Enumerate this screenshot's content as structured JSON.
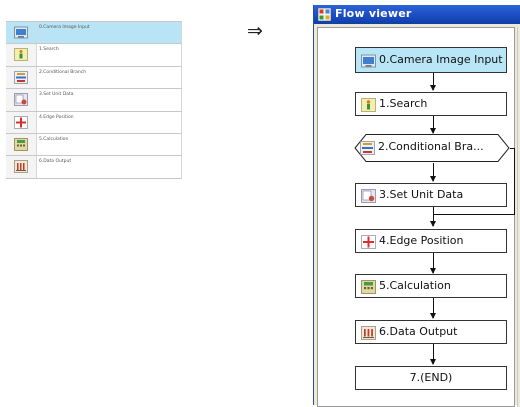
{
  "unit_list": {
    "rows": [
      {
        "label": "0.Camera Image Input",
        "icon": "camera-icon",
        "selected": true
      },
      {
        "label": "1.Search",
        "icon": "search-unit-icon",
        "selected": false
      },
      {
        "label": "2.Conditional Branch",
        "icon": "branch-icon",
        "selected": false
      },
      {
        "label": "3.Set Unit Data",
        "icon": "set-data-icon",
        "selected": false
      },
      {
        "label": "4.Edge Position",
        "icon": "edge-position-icon",
        "selected": false
      },
      {
        "label": "5.Calculation",
        "icon": "calculation-icon",
        "selected": false
      },
      {
        "label": "6.Data Output",
        "icon": "data-output-icon",
        "selected": false
      }
    ]
  },
  "arrow_symbol": "⇒",
  "flow_viewer": {
    "title": "Flow viewer",
    "nodes": [
      {
        "label": "0.Camera Image Input",
        "icon": "camera-icon",
        "selected": true
      },
      {
        "label": "1.Search",
        "icon": "search-unit-icon"
      },
      {
        "label": "2.Conditional Bra...",
        "icon": "branch-icon",
        "shape": "hexagon"
      },
      {
        "label": "3.Set Unit Data",
        "icon": "set-data-icon"
      },
      {
        "label": "4.Edge Position",
        "icon": "edge-position-icon"
      },
      {
        "label": "5.Calculation",
        "icon": "calculation-icon"
      },
      {
        "label": "6.Data Output",
        "icon": "data-output-icon"
      },
      {
        "label": "7.(END)",
        "icon": ""
      }
    ]
  },
  "colors": {
    "selected_bg": "#b9e6f6",
    "titlebar": "#1f51c6",
    "window_bg": "#ece9d8"
  }
}
